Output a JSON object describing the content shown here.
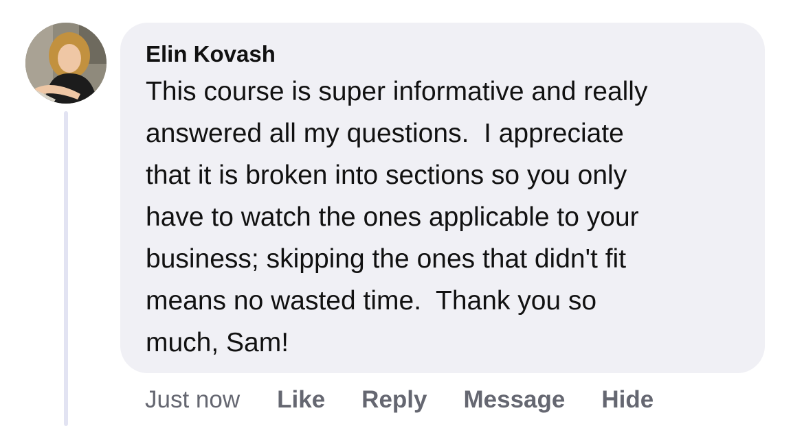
{
  "comment": {
    "author": "Elin Kovash",
    "text": "This course is super informative and really\nanswered all my questions.  I appreciate\nthat it is broken into sections so you only\nhave to watch the ones applicable to your\nbusiness; skipping the ones that didn't fit\nmeans no wasted time.  Thank you so\nmuch, Sam!",
    "timestamp": "Just now"
  },
  "actions": {
    "like": "Like",
    "reply": "Reply",
    "message": "Message",
    "hide": "Hide"
  },
  "colors": {
    "bubble": "#f0f0f5",
    "text": "#111111",
    "meta": "#656771",
    "thread_line": "#e2e3f2"
  }
}
